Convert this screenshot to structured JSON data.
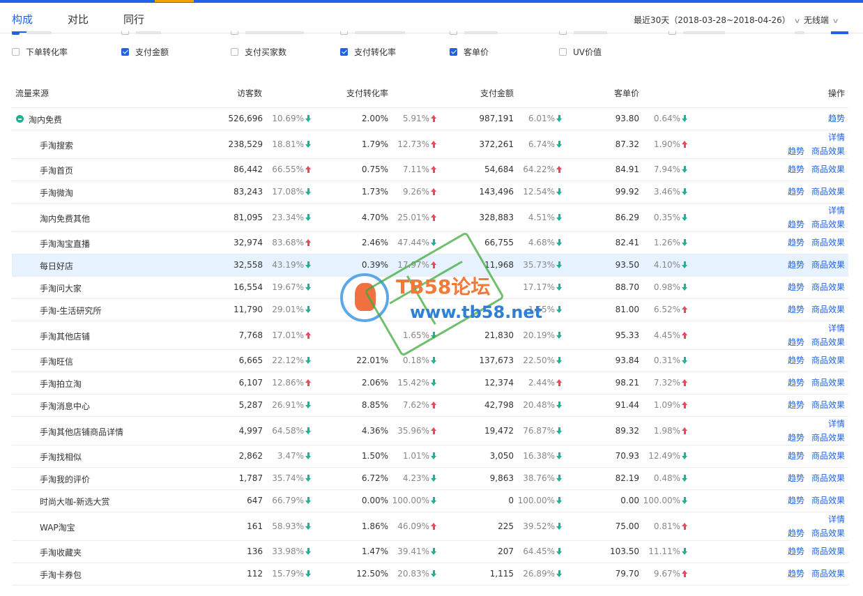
{
  "tabs": [
    "构成",
    "对比",
    "同行"
  ],
  "date_range": "最近30天（2018-03-28~2018-04-26）",
  "device": "无线端",
  "checkboxes": [
    {
      "label": "下单转化率",
      "checked": false
    },
    {
      "label": "支付金额",
      "checked": true
    },
    {
      "label": "支付买家数",
      "checked": false
    },
    {
      "label": "支付转化率",
      "checked": true
    },
    {
      "label": "客单价",
      "checked": true
    },
    {
      "label": "UV价值",
      "checked": false
    }
  ],
  "columns": [
    "流量来源",
    "访客数",
    "支付转化率",
    "支付金额",
    "客单价",
    "操作"
  ],
  "rows": [
    {
      "name": "淘内免费",
      "group": true,
      "visitors": "526,696",
      "visitors_pct": "10.69%",
      "visitors_dir": "down",
      "conv": "2.00%",
      "conv_pct": "5.91%",
      "conv_dir": "up",
      "amount": "987,191",
      "amount_pct": "6.01%",
      "amount_dir": "down",
      "price": "93.80",
      "price_pct": "0.64%",
      "price_dir": "down",
      "ops": [
        [
          "趋势"
        ]
      ]
    },
    {
      "name": "手淘搜索",
      "visitors": "238,529",
      "visitors_pct": "18.81%",
      "visitors_dir": "down",
      "conv": "1.79%",
      "conv_pct": "12.73%",
      "conv_dir": "up",
      "amount": "372,261",
      "amount_pct": "6.74%",
      "amount_dir": "down",
      "price": "87.32",
      "price_pct": "1.90%",
      "price_dir": "up",
      "ops": [
        [
          "详情"
        ],
        [
          "趋势",
          "商品效果"
        ]
      ]
    },
    {
      "name": "手淘首页",
      "visitors": "86,442",
      "visitors_pct": "66.55%",
      "visitors_dir": "up",
      "conv": "0.75%",
      "conv_pct": "7.11%",
      "conv_dir": "up",
      "amount": "54,684",
      "amount_pct": "64.22%",
      "amount_dir": "up",
      "price": "84.91",
      "price_pct": "7.94%",
      "price_dir": "down",
      "ops": [
        [
          "趋势",
          "商品效果"
        ]
      ]
    },
    {
      "name": "手淘微淘",
      "visitors": "83,243",
      "visitors_pct": "17.08%",
      "visitors_dir": "down",
      "conv": "1.73%",
      "conv_pct": "9.26%",
      "conv_dir": "up",
      "amount": "143,496",
      "amount_pct": "12.54%",
      "amount_dir": "down",
      "price": "99.92",
      "price_pct": "3.46%",
      "price_dir": "down",
      "ops": [
        [
          "趋势",
          "商品效果"
        ]
      ]
    },
    {
      "name": "淘内免费其他",
      "visitors": "81,095",
      "visitors_pct": "23.34%",
      "visitors_dir": "down",
      "conv": "4.70%",
      "conv_pct": "25.01%",
      "conv_dir": "up",
      "amount": "328,883",
      "amount_pct": "4.51%",
      "amount_dir": "down",
      "price": "86.29",
      "price_pct": "0.35%",
      "price_dir": "down",
      "ops": [
        [
          "详情"
        ],
        [
          "趋势",
          "商品效果"
        ]
      ]
    },
    {
      "name": "手淘淘宝直播",
      "visitors": "32,974",
      "visitors_pct": "83.68%",
      "visitors_dir": "up",
      "conv": "2.46%",
      "conv_pct": "47.44%",
      "conv_dir": "down",
      "amount": "66,755",
      "amount_pct": "4.68%",
      "amount_dir": "down",
      "price": "82.41",
      "price_pct": "1.26%",
      "price_dir": "down",
      "ops": [
        [
          "趋势",
          "商品效果"
        ]
      ]
    },
    {
      "name": "每日好店",
      "highlight": true,
      "visitors": "32,558",
      "visitors_pct": "43.19%",
      "visitors_dir": "down",
      "conv": "0.39%",
      "conv_pct": "17.97%",
      "conv_dir": "up",
      "amount": "11,968",
      "amount_pct": "35.73%",
      "amount_dir": "down",
      "price": "93.50",
      "price_pct": "4.10%",
      "price_dir": "down",
      "ops": [
        [
          "趋势",
          "商品效果"
        ]
      ]
    },
    {
      "name": "手淘问大家",
      "visitors": "16,554",
      "visitors_pct": "19.67%",
      "visitors_dir": "down",
      "conv": "",
      "conv_pct": "",
      "conv_dir": "",
      "amount": "",
      "amount_pct": "17.17%",
      "amount_dir": "down",
      "price": "88.70",
      "price_pct": "0.98%",
      "price_dir": "down",
      "ops": [
        [
          "趋势",
          "商品效果"
        ]
      ]
    },
    {
      "name": "手淘-生活研究所",
      "visitors": "11,790",
      "visitors_pct": "29.01%",
      "visitors_dir": "down",
      "conv": "",
      "conv_pct": "",
      "conv_dir": "",
      "amount": "",
      "amount_pct": "1.55%",
      "amount_dir": "down",
      "price": "81.00",
      "price_pct": "6.52%",
      "price_dir": "up",
      "ops": [
        [
          "趋势",
          "商品效果"
        ]
      ]
    },
    {
      "name": "手淘其他店铺",
      "visitors": "7,768",
      "visitors_pct": "17.01%",
      "visitors_dir": "up",
      "conv": "",
      "conv_pct": "1.65%",
      "conv_dir": "down",
      "amount": "21,830",
      "amount_pct": "20.19%",
      "amount_dir": "down",
      "price": "95.33",
      "price_pct": "4.45%",
      "price_dir": "up",
      "ops": [
        [
          "详情"
        ],
        [
          "趋势",
          "商品效果"
        ]
      ]
    },
    {
      "name": "手淘旺信",
      "visitors": "6,665",
      "visitors_pct": "22.12%",
      "visitors_dir": "down",
      "conv": "22.01%",
      "conv_pct": "0.18%",
      "conv_dir": "down",
      "amount": "137,673",
      "amount_pct": "22.50%",
      "amount_dir": "down",
      "price": "93.84",
      "price_pct": "0.31%",
      "price_dir": "down",
      "ops": [
        [
          "趋势",
          "商品效果"
        ]
      ]
    },
    {
      "name": "手淘拍立淘",
      "visitors": "6,107",
      "visitors_pct": "12.86%",
      "visitors_dir": "up",
      "conv": "2.06%",
      "conv_pct": "15.42%",
      "conv_dir": "down",
      "amount": "12,374",
      "amount_pct": "2.44%",
      "amount_dir": "up",
      "price": "98.21",
      "price_pct": "7.32%",
      "price_dir": "up",
      "ops": [
        [
          "趋势",
          "商品效果"
        ]
      ]
    },
    {
      "name": "手淘消息中心",
      "visitors": "5,287",
      "visitors_pct": "26.91%",
      "visitors_dir": "down",
      "conv": "8.85%",
      "conv_pct": "7.62%",
      "conv_dir": "up",
      "amount": "42,798",
      "amount_pct": "20.48%",
      "amount_dir": "down",
      "price": "91.44",
      "price_pct": "1.09%",
      "price_dir": "up",
      "ops": [
        [
          "趋势",
          "商品效果"
        ]
      ]
    },
    {
      "name": "手淘其他店铺商品详情",
      "visitors": "4,997",
      "visitors_pct": "64.58%",
      "visitors_dir": "down",
      "conv": "4.36%",
      "conv_pct": "35.96%",
      "conv_dir": "up",
      "amount": "19,472",
      "amount_pct": "76.87%",
      "amount_dir": "down",
      "price": "89.32",
      "price_pct": "1.98%",
      "price_dir": "up",
      "ops": [
        [
          "详情"
        ],
        [
          "趋势",
          "商品效果"
        ]
      ]
    },
    {
      "name": "手淘找相似",
      "visitors": "2,862",
      "visitors_pct": "3.47%",
      "visitors_dir": "down",
      "conv": "1.50%",
      "conv_pct": "1.01%",
      "conv_dir": "down",
      "amount": "3,050",
      "amount_pct": "16.38%",
      "amount_dir": "down",
      "price": "70.93",
      "price_pct": "12.49%",
      "price_dir": "down",
      "ops": [
        [
          "趋势",
          "商品效果"
        ]
      ]
    },
    {
      "name": "手淘我的评价",
      "visitors": "1,787",
      "visitors_pct": "35.74%",
      "visitors_dir": "down",
      "conv": "6.72%",
      "conv_pct": "4.23%",
      "conv_dir": "down",
      "amount": "9,863",
      "amount_pct": "38.76%",
      "amount_dir": "down",
      "price": "82.19",
      "price_pct": "0.48%",
      "price_dir": "down",
      "ops": [
        [
          "趋势",
          "商品效果"
        ]
      ]
    },
    {
      "name": "时尚大咖-新选大赏",
      "visitors": "647",
      "visitors_pct": "66.79%",
      "visitors_dir": "down",
      "conv": "0.00%",
      "conv_pct": "100.00%",
      "conv_dir": "down",
      "amount": "0",
      "amount_pct": "100.00%",
      "amount_dir": "down",
      "price": "0.00",
      "price_pct": "100.00%",
      "price_dir": "down",
      "ops": [
        [
          "趋势",
          "商品效果"
        ]
      ]
    },
    {
      "name": "WAP淘宝",
      "visitors": "161",
      "visitors_pct": "58.93%",
      "visitors_dir": "down",
      "conv": "1.86%",
      "conv_pct": "46.09%",
      "conv_dir": "up",
      "amount": "225",
      "amount_pct": "39.52%",
      "amount_dir": "down",
      "price": "75.00",
      "price_pct": "0.81%",
      "price_dir": "up",
      "ops": [
        [
          "详情"
        ],
        [
          "趋势",
          "商品效果"
        ]
      ]
    },
    {
      "name": "手淘收藏夹",
      "visitors": "136",
      "visitors_pct": "33.98%",
      "visitors_dir": "down",
      "conv": "1.47%",
      "conv_pct": "39.41%",
      "conv_dir": "down",
      "amount": "207",
      "amount_pct": "64.45%",
      "amount_dir": "down",
      "price": "103.50",
      "price_pct": "11.11%",
      "price_dir": "down",
      "ops": [
        [
          "趋势",
          "商品效果"
        ]
      ]
    },
    {
      "name": "手淘卡券包",
      "visitors": "112",
      "visitors_pct": "15.79%",
      "visitors_dir": "down",
      "conv": "12.50%",
      "conv_pct": "20.83%",
      "conv_dir": "down",
      "amount": "1,115",
      "amount_pct": "26.89%",
      "amount_dir": "down",
      "price": "79.70",
      "price_pct": "9.67%",
      "price_dir": "up",
      "ops": [
        [
          "趋势",
          "商品效果"
        ]
      ]
    }
  ],
  "watermark": {
    "title": "TB58论坛",
    "url": "www.tb58.net"
  },
  "colors": {
    "accent": "#2062e6",
    "down": "#1ab394",
    "up": "#f0455b",
    "highlight": "#e6f2ff"
  }
}
